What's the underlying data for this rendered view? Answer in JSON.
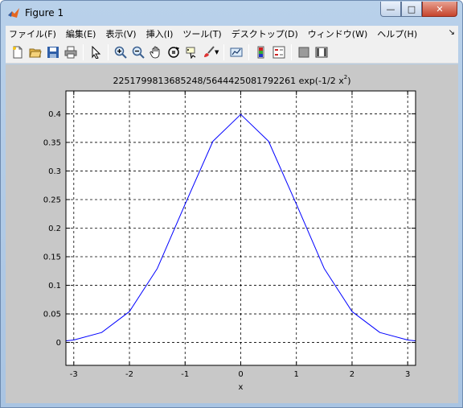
{
  "window": {
    "title": "Figure 1",
    "minimize_label": "—",
    "maximize_label": "□",
    "close_label": "✕"
  },
  "menu": {
    "items": [
      {
        "label": "ファイル(F)"
      },
      {
        "label": "編集(E)"
      },
      {
        "label": "表示(V)"
      },
      {
        "label": "挿入(I)"
      },
      {
        "label": "ツール(T)"
      },
      {
        "label": "デスクトップ(D)"
      },
      {
        "label": "ウィンドウ(W)"
      },
      {
        "label": "ヘルプ(H)"
      }
    ],
    "dock_label": "↘"
  },
  "toolbar": {
    "icons": [
      "new-figure-icon",
      "open-file-icon",
      "save-icon",
      "print-icon",
      "edit-plot-arrow-icon",
      "zoom-in-icon",
      "zoom-out-icon",
      "pan-hand-icon",
      "rotate-3d-icon",
      "data-cursor-icon",
      "brush-icon",
      "link-plot-icon",
      "insert-colorbar-icon",
      "insert-legend-icon",
      "hide-plot-tools-icon",
      "show-plot-tools-icon"
    ]
  },
  "chart_data": {
    "type": "line",
    "title_main": "2251799813685248/5644425081792261 exp(-1/2 x",
    "title_sup": "2",
    "title_tail": ")",
    "xlabel": "x",
    "ylabel": "",
    "xlim": [
      -3.1416,
      3.1416
    ],
    "ylim": [
      -0.04,
      0.44
    ],
    "xticks": [
      -3,
      -2,
      -1,
      0,
      1,
      2,
      3
    ],
    "yticks": [
      0,
      0.05,
      0.1,
      0.15,
      0.2,
      0.25,
      0.3,
      0.35,
      0.4
    ],
    "ytick_labels": [
      "0",
      "0.05",
      "0.1",
      "0.15",
      "0.2",
      "0.25",
      "0.3",
      "0.35",
      "0.4"
    ],
    "grid": true,
    "line_color": "#0000ff",
    "series": [
      {
        "x": [
          -3.14,
          -3.0,
          -2.5,
          -2.0,
          -1.5,
          -1.0,
          -0.5,
          0.0,
          0.5,
          1.0,
          1.5,
          2.0,
          2.5,
          3.0,
          3.14
        ],
        "y": [
          0.0029,
          0.0044,
          0.0175,
          0.054,
          0.1295,
          0.242,
          0.352,
          0.3989,
          0.352,
          0.242,
          0.1295,
          0.054,
          0.0175,
          0.0044,
          0.0029
        ]
      }
    ]
  }
}
